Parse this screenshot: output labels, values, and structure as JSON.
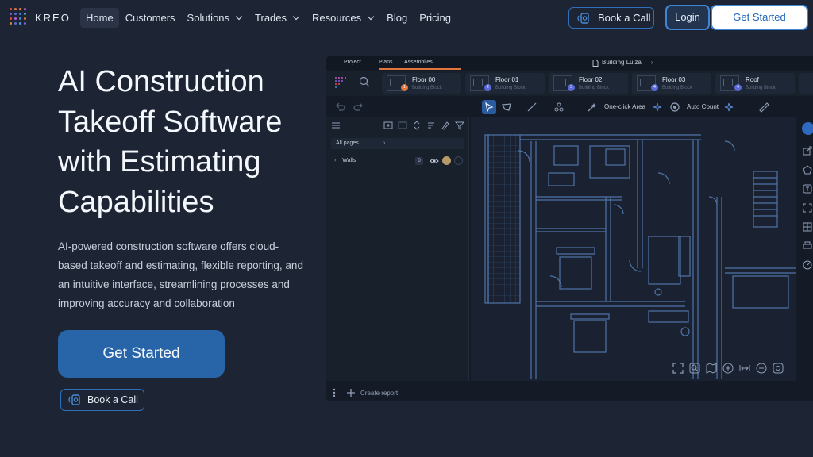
{
  "brand": {
    "name": "KREO",
    "dot_colors": [
      "#e04e4e",
      "#e0743a",
      "#d68a3a",
      "#c256c9",
      "#8a5ad8",
      "#5a6ad8",
      "#3f86d8",
      "#4aa3d8"
    ]
  },
  "nav": {
    "items": [
      {
        "label": "Home",
        "active": true,
        "dropdown": false
      },
      {
        "label": "Customers",
        "active": false,
        "dropdown": false
      },
      {
        "label": "Solutions",
        "active": false,
        "dropdown": true
      },
      {
        "label": "Trades",
        "active": false,
        "dropdown": true
      },
      {
        "label": "Resources",
        "active": false,
        "dropdown": true
      },
      {
        "label": "Blog",
        "active": false,
        "dropdown": false
      },
      {
        "label": "Pricing",
        "active": false,
        "dropdown": false
      }
    ],
    "book_call": "Book a Call",
    "login": "Login",
    "get_started": "Get Started"
  },
  "hero": {
    "title": "AI Construction Takeoff Software with Estimating Capabilities",
    "description": "AI-powered construction software offers cloud-based takeoff and estimating, flexible reporting, and an intuitive interface, streamlining processes and improving accuracy and collaboration",
    "cta_primary": "Get Started",
    "cta_secondary": "Book a Call"
  },
  "app": {
    "tabs": [
      "Project",
      "Plans",
      "Assemblies"
    ],
    "active_tab": "Plans",
    "document": "Building Luiza",
    "floors": [
      {
        "name": "Floor 00",
        "sub": "Building Block",
        "badge": "1",
        "badge_color": "#e0743a"
      },
      {
        "name": "Floor 01",
        "sub": "Building Block",
        "badge": "2",
        "badge_color": "#5a6ad8"
      },
      {
        "name": "Floor 02",
        "sub": "Building Block",
        "badge": "3",
        "badge_color": "#5a6ad8"
      },
      {
        "name": "Floor 03",
        "sub": "Building Block",
        "badge": "4",
        "badge_color": "#5a6ad8"
      },
      {
        "name": "Roof",
        "sub": "Building Block",
        "badge": "4",
        "badge_color": "#5a6ad8"
      }
    ],
    "toolbar": {
      "one_click_area": "One-click Area",
      "auto_count": "Auto Count"
    },
    "sidebar": {
      "all_pages": "All pages",
      "layer": "Walls",
      "layer_count": "0"
    },
    "bottom": {
      "create_report": "Create report"
    }
  }
}
